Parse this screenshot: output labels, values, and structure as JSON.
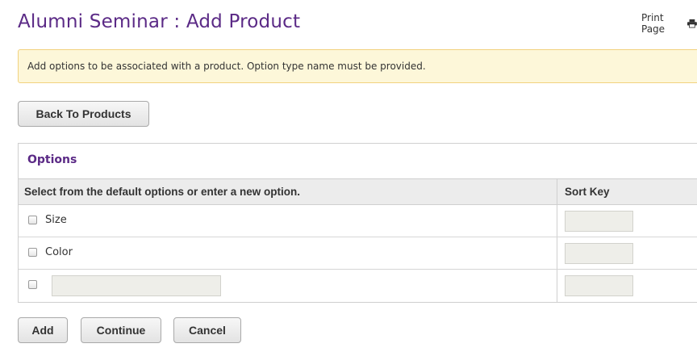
{
  "header": {
    "title": "Alumni Seminar : Add Product",
    "print_label": "Print Page",
    "print_icon": "printer-icon"
  },
  "notice": {
    "text": "Add options to be associated with a product. Option type name must be provided."
  },
  "buttons": {
    "back": "Back To Products",
    "add": "Add",
    "continue": "Continue",
    "cancel": "Cancel"
  },
  "options_panel": {
    "title": "Options",
    "columns": [
      "Select from the default options or enter a new option.",
      "Sort Key"
    ],
    "rows": [
      {
        "label": "Size",
        "checked": false,
        "sort_key": ""
      },
      {
        "label": "Color",
        "checked": false,
        "sort_key": ""
      },
      {
        "label": "",
        "checked": false,
        "sort_key": "",
        "custom_input_value": ""
      }
    ]
  },
  "colors": {
    "title": "#5b2a86",
    "notice_bg": "#fdf7d9",
    "notice_border": "#f2d27f"
  }
}
